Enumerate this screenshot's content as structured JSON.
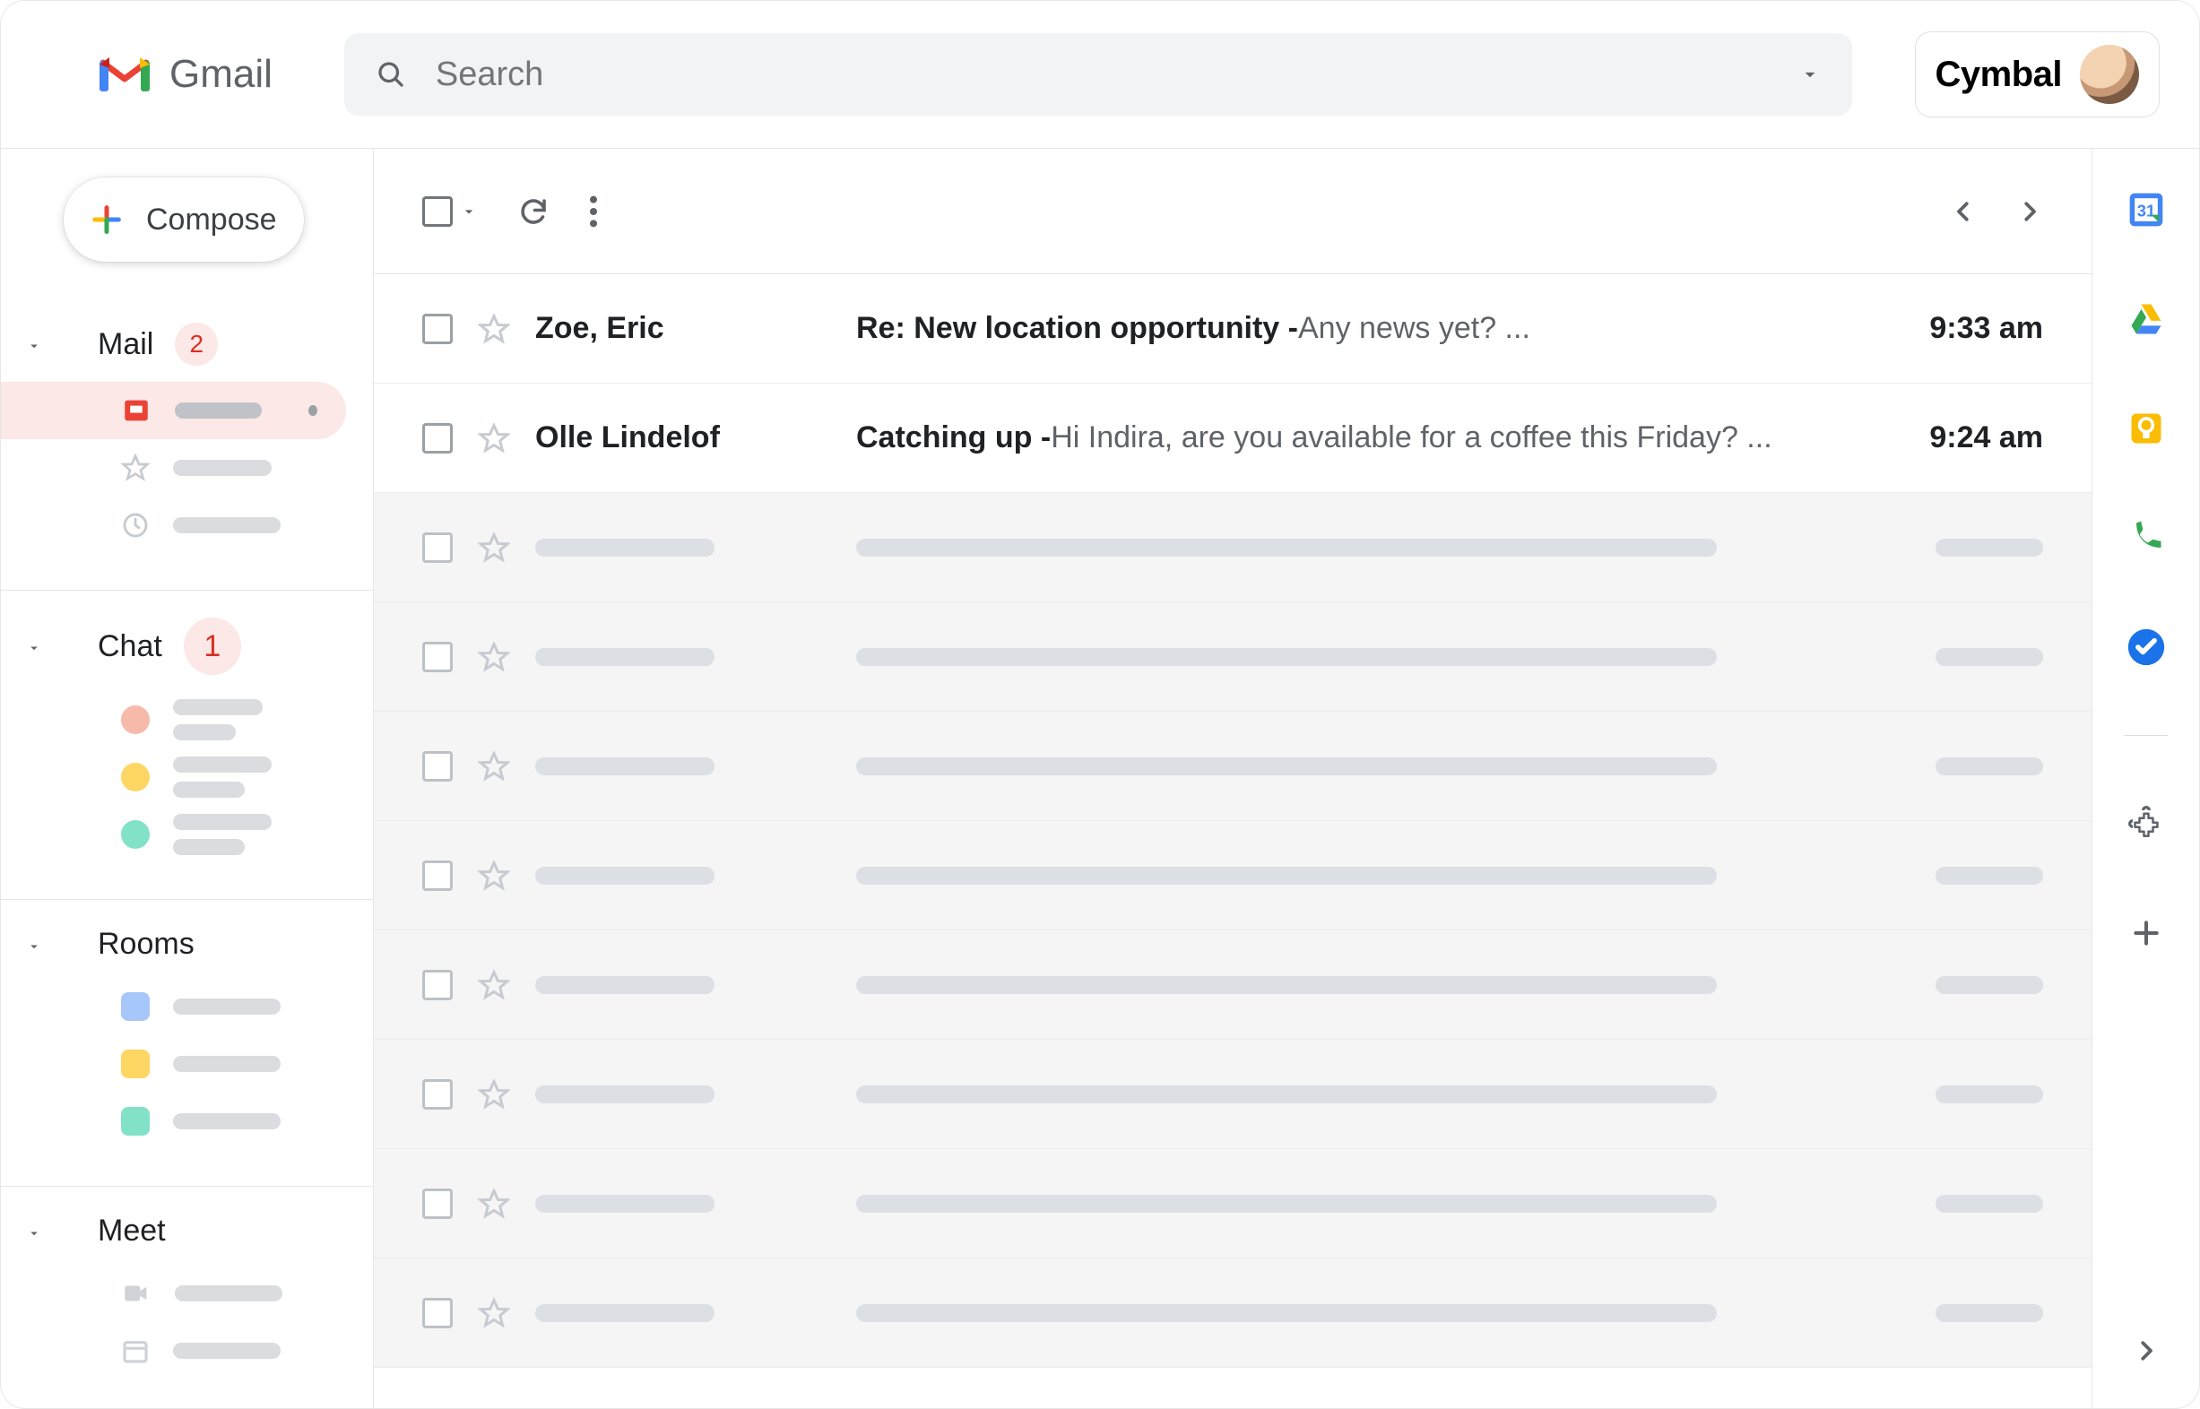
{
  "header": {
    "app_name": "Gmail",
    "search_placeholder": "Search",
    "brand_label": "Cymbal"
  },
  "compose_label": "Compose",
  "sidebar": {
    "sections": [
      {
        "label": "Mail",
        "badge": "2",
        "badge_style": "red-soft"
      },
      {
        "label": "Chat",
        "badge": "1",
        "badge_style": "red-large"
      },
      {
        "label": "Rooms",
        "badge": "",
        "badge_style": ""
      },
      {
        "label": "Meet",
        "badge": "",
        "badge_style": ""
      }
    ]
  },
  "emails": [
    {
      "sender": "Zoe, Eric",
      "subject": "Re: New location opportunity",
      "snippet": "Any news yet? ...",
      "time": "9:33 am",
      "unread": true
    },
    {
      "sender": "Olle Lindelof",
      "subject": "Catching up",
      "snippet": "Hi Indira, are you available for a coffee this Friday? ...",
      "time": "9:24 am",
      "unread": true
    }
  ],
  "placeholder_row_count": 8,
  "rail_apps": [
    "calendar",
    "drive",
    "keep",
    "contacts-voice",
    "tasks"
  ]
}
